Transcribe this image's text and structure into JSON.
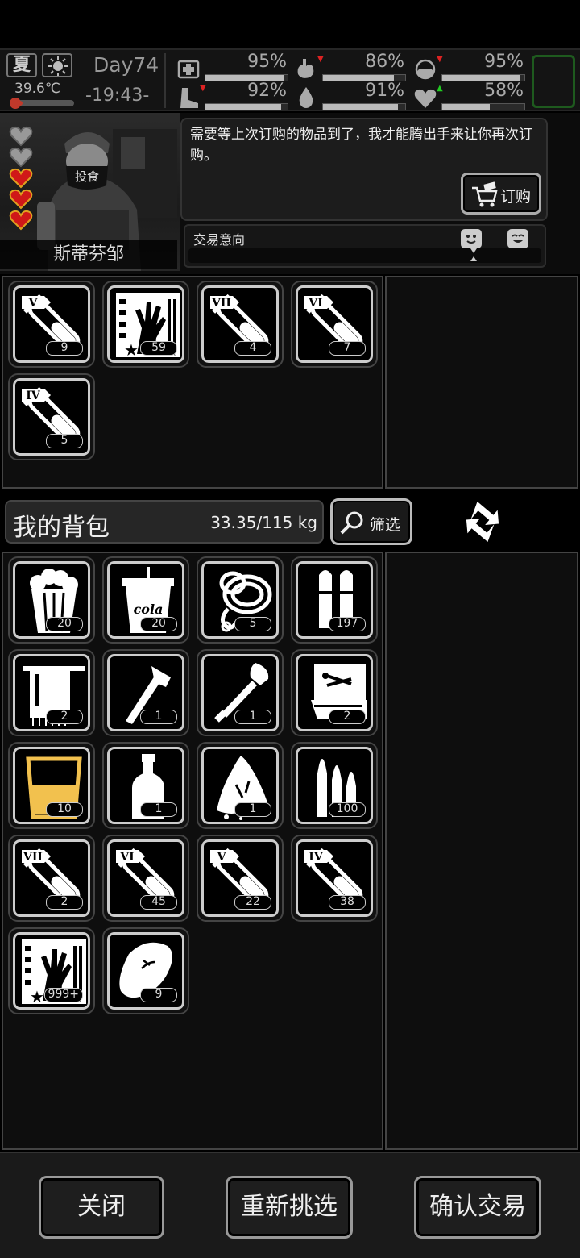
{
  "status": {
    "season": "夏",
    "temperature": "39.6℃",
    "temperature_level": 0.1,
    "day": "Day74",
    "time": "-19:43-",
    "stats": [
      {
        "name": "health",
        "icon": "medkit-icon",
        "value": "95%",
        "level": 0.95,
        "arrow": ""
      },
      {
        "name": "hunger",
        "icon": "stomach-icon",
        "value": "86%",
        "level": 0.86,
        "arrow": "down"
      },
      {
        "name": "drug",
        "icon": "pill-icon",
        "value": "95%",
        "level": 0.95,
        "arrow": "down"
      },
      {
        "name": "stamina",
        "icon": "boot-icon",
        "value": "92%",
        "level": 0.92,
        "arrow": "down"
      },
      {
        "name": "thirst",
        "icon": "water-drop-icon",
        "value": "91%",
        "level": 0.91,
        "arrow": ""
      },
      {
        "name": "mood",
        "icon": "heart-icon",
        "value": "58%",
        "level": 0.58,
        "arrow": "up"
      }
    ],
    "accent_green": "#1e5a1e"
  },
  "npc": {
    "name": "斯蒂芬邹",
    "hearts": [
      "empty",
      "empty",
      "full",
      "full",
      "full"
    ],
    "dialog": "需要等上次订购的物品到了，我才能腾出手来让你再次订购。",
    "order_button": "订购",
    "trade_intent_label": "交易意向",
    "mask_text": "投食"
  },
  "trader_items": [
    {
      "icon": "test-tube-icon",
      "tier": "V",
      "count": "9"
    },
    {
      "icon": "film-zombie-hand-icon",
      "count": "59"
    },
    {
      "icon": "test-tube-icon",
      "tier": "VII",
      "count": "4"
    },
    {
      "icon": "test-tube-icon",
      "tier": "VI",
      "count": "7"
    },
    {
      "icon": "test-tube-icon",
      "tier": "IV",
      "count": "5"
    }
  ],
  "backpack": {
    "title": "我的背包",
    "weight": "33.35/115 kg",
    "filter_label": "筛选",
    "items": [
      {
        "icon": "popcorn-icon",
        "count": "20"
      },
      {
        "icon": "cola-cup-icon",
        "count": "20",
        "text": "cola"
      },
      {
        "icon": "rope-icon",
        "count": "5"
      },
      {
        "icon": "bullets-icon",
        "count": "197"
      },
      {
        "icon": "towel-icon",
        "count": "2"
      },
      {
        "icon": "axe-icon",
        "count": "1"
      },
      {
        "icon": "shovel-icon",
        "count": "1"
      },
      {
        "icon": "toolbox-icon",
        "count": "2"
      },
      {
        "icon": "glass-drink-icon",
        "count": "10"
      },
      {
        "icon": "bottle-icon",
        "count": "1"
      },
      {
        "icon": "cloth-rag-icon",
        "count": "1"
      },
      {
        "icon": "rifle-bullets-icon",
        "count": "100"
      },
      {
        "icon": "test-tube-icon",
        "tier": "VII",
        "count": "2"
      },
      {
        "icon": "test-tube-icon",
        "tier": "VI",
        "count": "45"
      },
      {
        "icon": "test-tube-icon",
        "tier": "V",
        "count": "22"
      },
      {
        "icon": "test-tube-icon",
        "tier": "IV",
        "count": "38"
      },
      {
        "icon": "film-zombie-hand-icon",
        "count": "999+"
      },
      {
        "icon": "meat-icon",
        "count": "9"
      }
    ]
  },
  "footer": {
    "close": "关闭",
    "reselect": "重新挑选",
    "confirm": "确认交易"
  },
  "colors": {
    "drink_yellow": "#f2c14e",
    "heart_red": "#d01818",
    "heart_gold": "#e0a020"
  }
}
